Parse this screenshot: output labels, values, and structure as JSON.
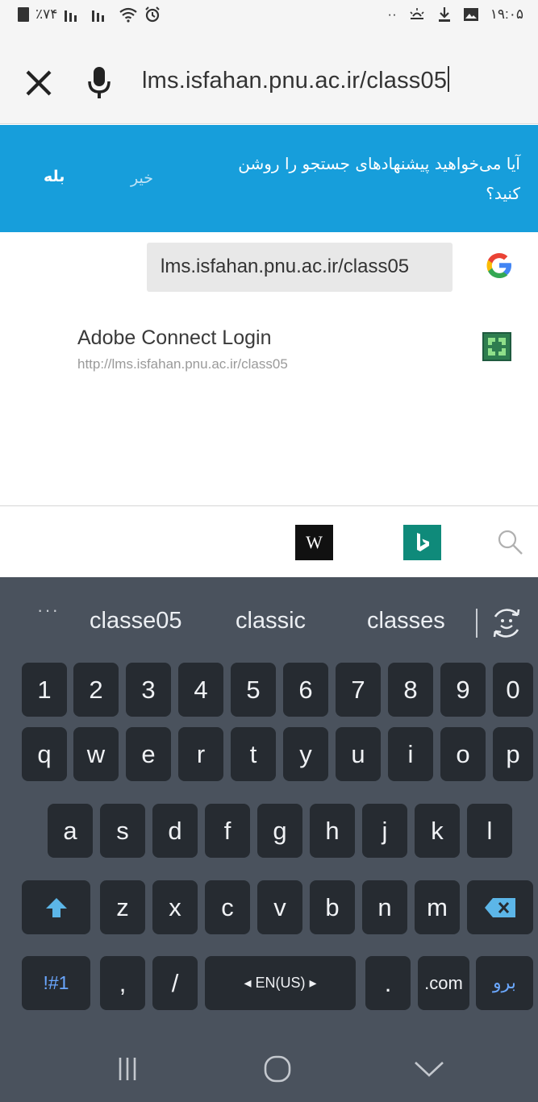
{
  "status_bar": {
    "battery": "٪۷۴",
    "time": "۱۹:۰۵",
    "dots": "··"
  },
  "url_bar": {
    "url_text": "lms.isfahan.pnu.ac.ir/class05"
  },
  "banner": {
    "question": "آیا می‌خواهید پیشنهادهای جستجو را روشن کنید؟",
    "no_label": "خیر",
    "yes_label": "بله"
  },
  "suggestions": {
    "google_query": "lms.isfahan.pnu.ac.ir/class05",
    "page_title": "Adobe Connect Login",
    "page_url": "http://lms.isfahan.pnu.ac.ir/class05"
  },
  "engines": {
    "wikipedia_label": "W"
  },
  "keyboard": {
    "more": "···",
    "suggestions": [
      "classe05",
      "classic",
      "classes"
    ],
    "row_numbers": [
      "1",
      "2",
      "3",
      "4",
      "5",
      "6",
      "7",
      "8",
      "9",
      "0"
    ],
    "row1": [
      "q",
      "w",
      "e",
      "r",
      "t",
      "y",
      "u",
      "i",
      "o",
      "p"
    ],
    "row2": [
      "a",
      "s",
      "d",
      "f",
      "g",
      "h",
      "j",
      "k",
      "l"
    ],
    "row3": [
      "z",
      "x",
      "c",
      "v",
      "b",
      "n",
      "m"
    ],
    "symbols_label": "!#1",
    "comma": ",",
    "slash": "/",
    "language": "◂ EN(US) ▸",
    "period": ".",
    "dotcom": ".com",
    "go_label": "برو"
  },
  "colors": {
    "banner_bg": "#179edb",
    "keyboard_bg": "#4a525d",
    "key_bg": "#262b31",
    "shift_accent": "#5cb6e8",
    "go_accent": "#6aa7ff",
    "bing_green": "#0f8a7a"
  },
  "icons": {
    "close": "close-icon",
    "mic": "mic-icon",
    "google": "google-icon",
    "adobe_connect": "adobe-connect-icon",
    "wikipedia": "wikipedia-icon",
    "bing": "bing-icon",
    "search": "search-icon",
    "emoji": "emoji-icon",
    "shift": "shift-icon",
    "backspace": "backspace-icon",
    "recent_apps": "recent-apps-icon",
    "home": "home-icon",
    "back": "back-icon"
  }
}
